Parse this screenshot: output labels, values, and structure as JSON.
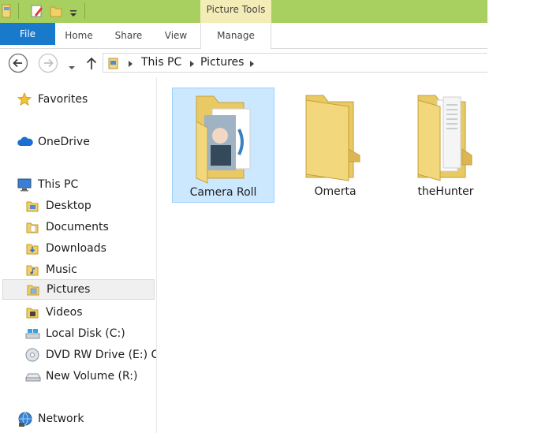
{
  "ribbon": {
    "context_group": "Picture Tools",
    "file_tab": "File",
    "tabs": [
      "Home",
      "Share",
      "View"
    ],
    "context_tab": "Manage",
    "accent_color": "#1979ca",
    "context_color": "#f3ecb7"
  },
  "address": {
    "crumbs": [
      "This PC",
      "Pictures"
    ]
  },
  "nav": {
    "favorites": "Favorites",
    "onedrive": "OneDrive",
    "this_pc": "This PC",
    "items": [
      {
        "label": "Desktop",
        "icon": "folder-desktop-icon"
      },
      {
        "label": "Documents",
        "icon": "folder-documents-icon"
      },
      {
        "label": "Downloads",
        "icon": "folder-downloads-icon"
      },
      {
        "label": "Music",
        "icon": "folder-music-icon"
      },
      {
        "label": "Pictures",
        "icon": "folder-pictures-icon",
        "selected": true
      },
      {
        "label": "Videos",
        "icon": "folder-videos-icon"
      },
      {
        "label": "Local Disk (C:)",
        "icon": "local-disk-icon"
      },
      {
        "label": "DVD RW Drive (E:) C/",
        "icon": "dvd-drive-icon"
      },
      {
        "label": "New Volume (R:)",
        "icon": "drive-icon"
      }
    ],
    "network": "Network"
  },
  "folders": [
    {
      "name": "Camera Roll",
      "selected": true
    },
    {
      "name": "Omerta"
    },
    {
      "name": "theHunter"
    }
  ]
}
